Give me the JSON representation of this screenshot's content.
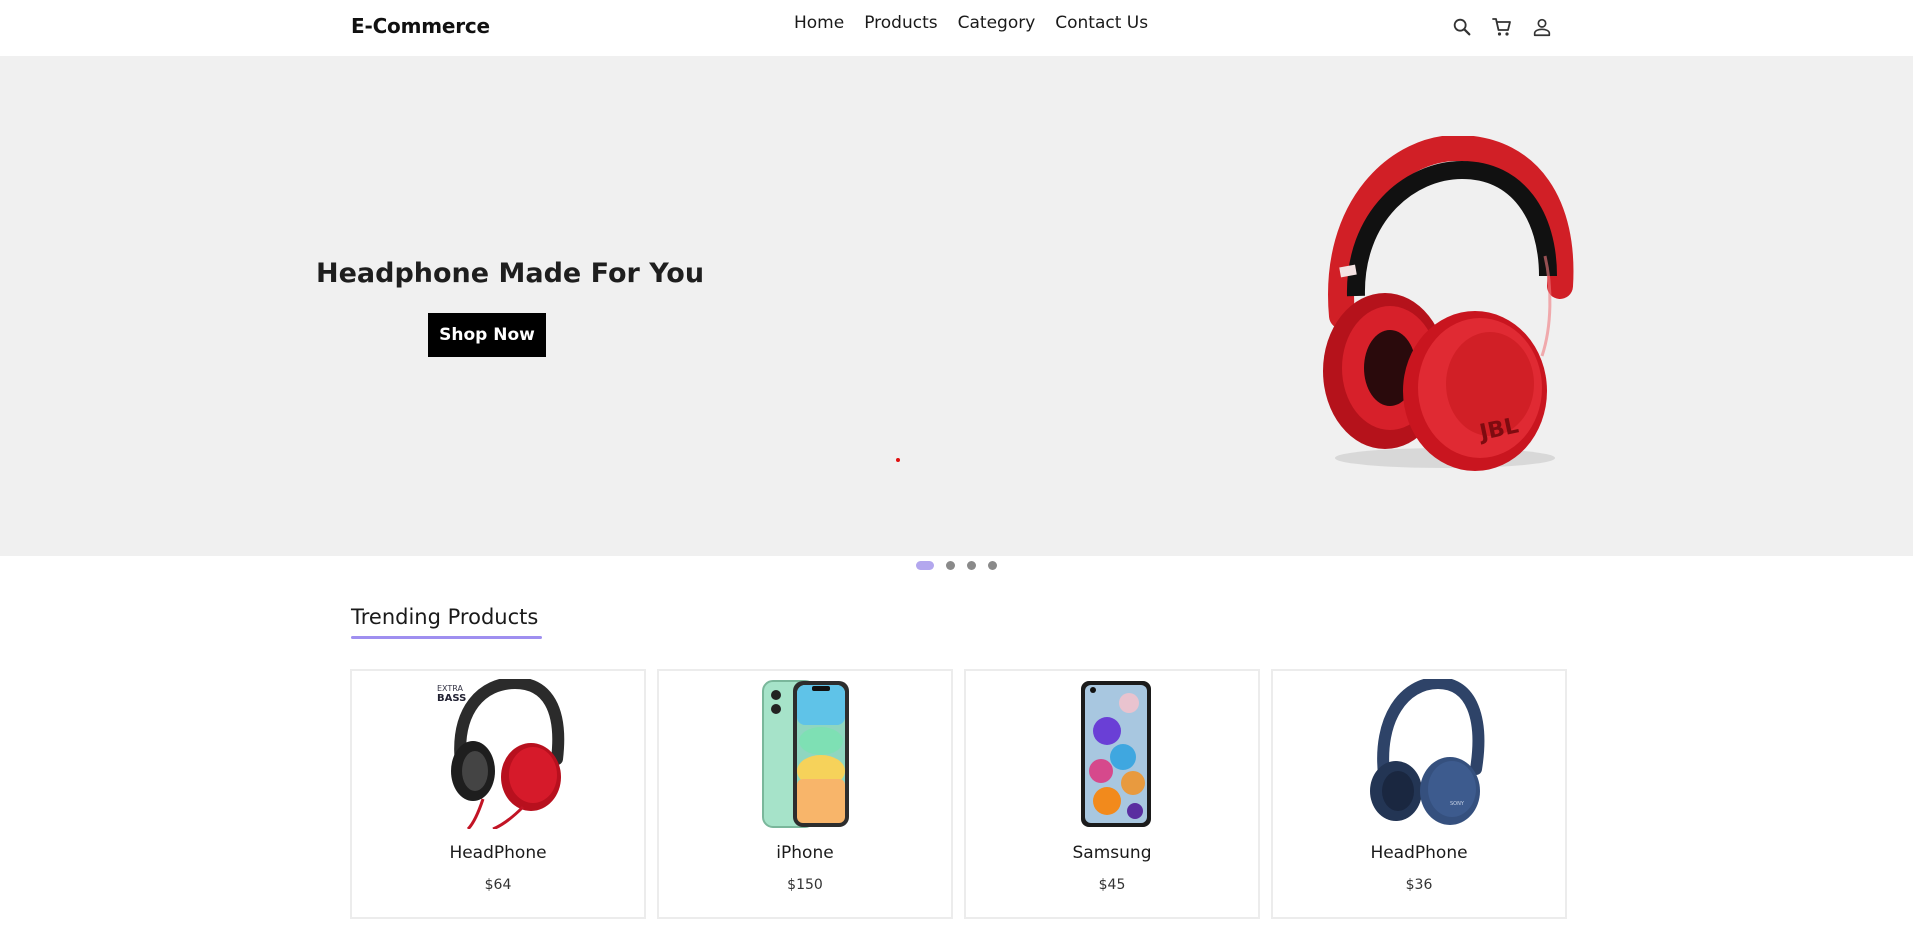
{
  "navbar": {
    "brand": "E-Commerce",
    "links": [
      "Home",
      "Products",
      "Category",
      "Contact Us"
    ],
    "icons": [
      "search-icon",
      "cart-icon",
      "user-icon"
    ]
  },
  "hero": {
    "title": "Headphone Made For You",
    "button_label": "Shop Now",
    "image": "red-headphone",
    "carousel": {
      "slides": 4,
      "active_index": 0
    }
  },
  "trending": {
    "title": "Trending Products",
    "products": [
      {
        "name": "HeadPhone",
        "price": "$64",
        "image": "black-red-headphone"
      },
      {
        "name": "iPhone",
        "price": "$150",
        "image": "green-iphone"
      },
      {
        "name": "Samsung",
        "price": "$45",
        "image": "samsung-phone"
      },
      {
        "name": "HeadPhone",
        "price": "$36",
        "image": "blue-headphone"
      }
    ]
  },
  "colors": {
    "accent": "#9f8ff0",
    "hero_bg": "#f0f0f0",
    "button_bg": "#000000"
  }
}
